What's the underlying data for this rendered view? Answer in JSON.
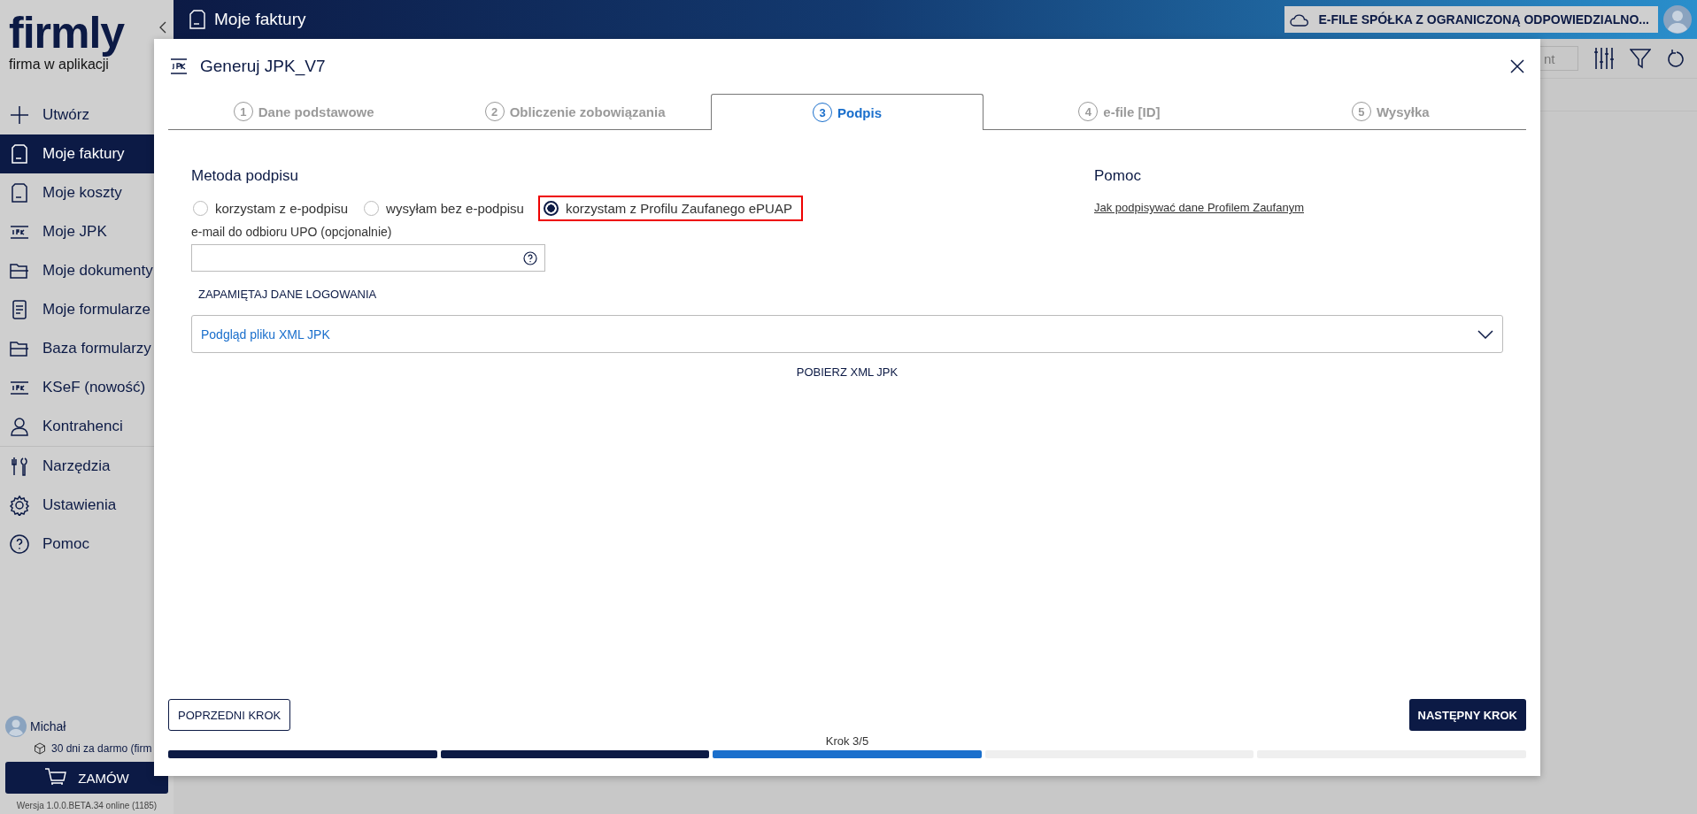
{
  "sidebar": {
    "logo": "firmly",
    "tagline": "firma w aplikacji",
    "item_groups": [
      [
        {
          "label": "Utwórz",
          "selected": false
        },
        {
          "label": "Moje faktury",
          "selected": true
        },
        {
          "label": "Moje koszty",
          "selected": false
        },
        {
          "label": "Moje JPK",
          "selected": false
        },
        {
          "label": "Moje dokumenty",
          "selected": false
        },
        {
          "label": "Moje formularze",
          "selected": false
        },
        {
          "label": "Baza formularzy",
          "selected": false
        },
        {
          "label": "KSeF (nowość)",
          "selected": false
        },
        {
          "label": "Kontrahenci",
          "selected": false
        }
      ],
      [
        {
          "label": "Narzędzia",
          "selected": false
        },
        {
          "label": "Ustawienia",
          "selected": false
        },
        {
          "label": "Pomoc",
          "selected": false
        }
      ]
    ],
    "user": {
      "name": "Michał",
      "plan": "30 dni za darmo (firm"
    },
    "order_button": "ZAMÓW",
    "version": "Wersja 1.0.0.BETA.34 online (1185)"
  },
  "header": {
    "title": "Moje faktury",
    "company": "E-FILE SPÓŁKA Z OGRANICZONĄ ODPOWIEDZIALNO..."
  },
  "toolbar": {
    "search": {
      "placeholder": "nt"
    }
  },
  "modal": {
    "title": "Generuj JPK_V7",
    "tabs": [
      {
        "number": "1",
        "label": "Dane podstawowe",
        "selected": false
      },
      {
        "number": "2",
        "label": "Obliczenie zobowiązania",
        "selected": false
      },
      {
        "number": "3",
        "label": "Podpis",
        "selected": true
      },
      {
        "number": "4",
        "label": "e-file [ID]",
        "selected": false
      },
      {
        "number": "5",
        "label": "Wysyłka",
        "selected": false
      }
    ],
    "section_title": "Metoda podpisu",
    "radios": [
      {
        "label": "korzystam z e-podpisu",
        "selected": false,
        "highlighted": false
      },
      {
        "label": "wysyłam bez e-podpisu",
        "selected": false,
        "highlighted": false
      },
      {
        "label": "korzystam z Profilu Zaufanego ePUAP",
        "selected": true,
        "highlighted": true
      }
    ],
    "email_label": "e-mail do odbioru UPO (opcjonalnie)",
    "remember_button": "ZAPAMIĘTAJ DANE LOGOWANIA",
    "preview": {
      "label": "Podgląd pliku XML JPK",
      "expanded": false
    },
    "download_button": "POBIERZ XML JPK",
    "help": {
      "title": "Pomoc",
      "link": "Jak podpisywać dane Profilem Zaufanym"
    },
    "prev_button": "POPRZEDNI KROK",
    "next_button": "NASTĘPNY KROK",
    "step_label": "Krok 3/5",
    "progress": [
      {
        "done": true,
        "selected": false
      },
      {
        "done": true,
        "selected": false
      },
      {
        "done": false,
        "selected": true
      },
      {
        "done": false,
        "selected": false
      },
      {
        "done": false,
        "selected": false
      }
    ]
  }
}
